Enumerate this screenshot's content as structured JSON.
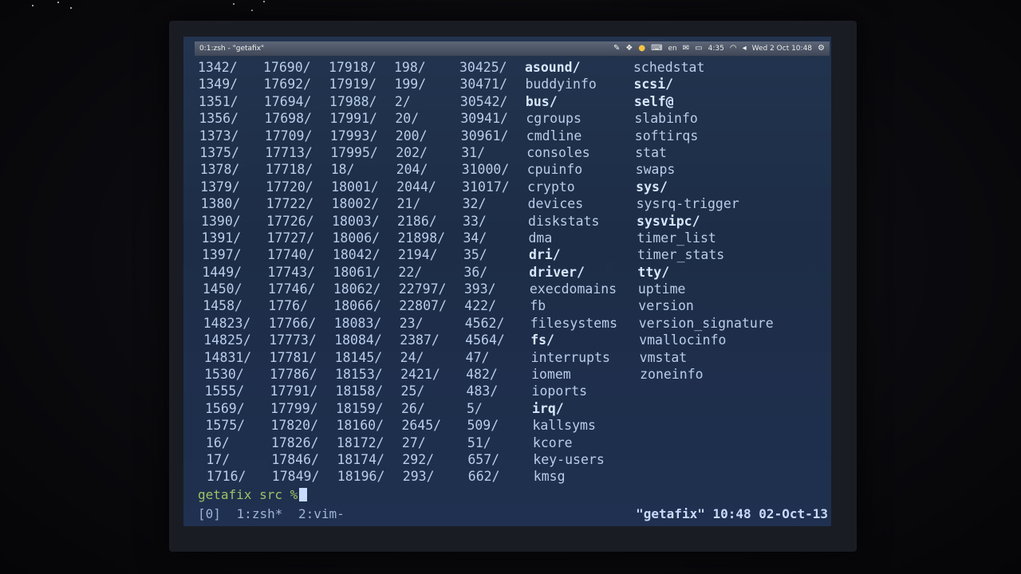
{
  "window": {
    "title": "0:1:zsh - \"getafix\""
  },
  "tray": {
    "keyboard_layout": "en",
    "battery_time": "4:35",
    "datetime": "Wed 2 Oct 10:48",
    "icons": [
      "edit-icon",
      "dropbox-icon",
      "chat-icon",
      "keyboard-icon",
      "mail-icon",
      "battery-icon",
      "wifi-icon",
      "volume-icon",
      "gear-icon"
    ]
  },
  "columns": [
    [
      "1342/",
      "1349/",
      "1351/",
      "1356/",
      "1373/",
      "1375/",
      "1378/",
      "1379/",
      "1380/",
      "1390/",
      "1391/",
      "1397/",
      "1449/",
      "1450/",
      "1458/",
      "14823/",
      "14825/",
      "14831/",
      "1530/",
      "1555/",
      "1569/",
      "1575/",
      "16/",
      "17/",
      "1716/"
    ],
    [
      "17690/",
      "17692/",
      "17694/",
      "17698/",
      "17709/",
      "17713/",
      "17718/",
      "17720/",
      "17722/",
      "17726/",
      "17727/",
      "17740/",
      "17743/",
      "17746/",
      "1776/",
      "17766/",
      "17773/",
      "17781/",
      "17786/",
      "17791/",
      "17799/",
      "17820/",
      "17826/",
      "17846/",
      "17849/"
    ],
    [
      "17918/",
      "17919/",
      "17988/",
      "17991/",
      "17993/",
      "17995/",
      "18/",
      "18001/",
      "18002/",
      "18003/",
      "18006/",
      "18042/",
      "18061/",
      "18062/",
      "18066/",
      "18083/",
      "18084/",
      "18145/",
      "18153/",
      "18158/",
      "18159/",
      "18160/",
      "18172/",
      "18174/",
      "18196/"
    ],
    [
      "198/",
      "199/",
      "2/",
      "20/",
      "200/",
      "202/",
      "204/",
      "2044/",
      "21/",
      "2186/",
      "21898/",
      "2194/",
      "22/",
      "22797/",
      "22807/",
      "23/",
      "2387/",
      "24/",
      "2421/",
      "25/",
      "26/",
      "2645/",
      "27/",
      "292/",
      "293/"
    ],
    [
      "30425/",
      "30471/",
      "30542/",
      "30941/",
      "30961/",
      "31/",
      "31000/",
      "31017/",
      "32/",
      "33/",
      "34/",
      "35/",
      "36/",
      "393/",
      "422/",
      "4562/",
      "4564/",
      "47/",
      "482/",
      "483/",
      "5/",
      "509/",
      "51/",
      "657/",
      "662/"
    ],
    [
      "asound/",
      "buddyinfo",
      "bus/",
      "cgroups",
      "cmdline",
      "consoles",
      "cpuinfo",
      "crypto",
      "devices",
      "diskstats",
      "dma",
      "dri/",
      "driver/",
      "execdomains",
      "fb",
      "filesystems",
      "fs/",
      "interrupts",
      "iomem",
      "ioports",
      "irq/",
      "kallsyms",
      "kcore",
      "key-users",
      "kmsg"
    ],
    [
      "schedstat",
      "scsi/",
      "self@",
      "slabinfo",
      "softirqs",
      "stat",
      "swaps",
      "sys/",
      "sysrq-trigger",
      "sysvipc/",
      "timer_list",
      "timer_stats",
      "tty/",
      "uptime",
      "version",
      "version_signature",
      "vmallocinfo",
      "vmstat",
      "zoneinfo"
    ]
  ],
  "bold_entries": [
    "asound/",
    "bus/",
    "dri/",
    "driver/",
    "fs/",
    "irq/",
    "scsi/",
    "self@",
    "sys/",
    "sysvipc/",
    "tty/"
  ],
  "prompt": {
    "text": "getafix src %"
  },
  "tmux": {
    "session": "[0]",
    "windows": [
      "1:zsh*",
      "2:vim-"
    ],
    "host": "\"getafix\"",
    "time": "10:48",
    "date": "02-Oct-13"
  }
}
